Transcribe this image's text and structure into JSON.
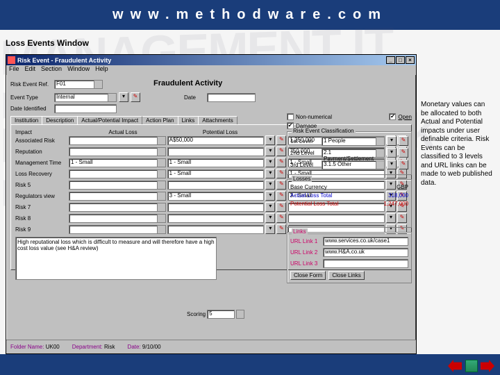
{
  "header": {
    "url": "www.methodware.com"
  },
  "section_title": "Loss Events Window",
  "callout": "Monetary values can be allocated to both Actual and Potential impacts under user definable criteria. Risk Events can be classified to 3 levels and URL links can be made to web published data.",
  "window": {
    "title": "Risk Event - Fraudulent Activity",
    "menu": [
      "File",
      "Edit",
      "Section",
      "Window",
      "Help"
    ],
    "risk_event_ref_label": "Risk Event Ref.",
    "risk_event_ref_value": "F01",
    "risk_event_name": "Fraudulent Activity",
    "event_type_label": "Event Type",
    "event_type_value": "Internal",
    "date_label": "Date",
    "date_value": "",
    "date_identified_label": "Date Identified",
    "date_identified_value": "",
    "cb_non_numerical": "Non-numerical",
    "cb_open": "Open",
    "cb_damage": "Damage",
    "tabs": [
      "Institution",
      "Description",
      "Actual/Potential Impact",
      "Action Plan",
      "Links",
      "Attachments"
    ],
    "col_headers": {
      "impact": "Impact",
      "actual": "Actual Loss",
      "potential": "Potential Loss"
    },
    "impact_rows": [
      {
        "label": "Associated Risk",
        "level": "",
        "actual": "A$50,000",
        "potential": "1,250,000"
      },
      {
        "label": "Reputation",
        "level": "",
        "actual": "",
        "potential": "750,000"
      },
      {
        "label": "Management Time",
        "level": "1 - Small",
        "actual": "1 - Small",
        "potential": "1 - Small"
      },
      {
        "label": "Loss Recovery",
        "level": "",
        "actual": "1 - Small",
        "potential": "1 - Small"
      },
      {
        "label": "Risk 5",
        "level": "",
        "actual": "",
        "potential": ""
      },
      {
        "label": "Regulators view",
        "level": "",
        "actual": "3 - Small",
        "potential": "3 - Small"
      },
      {
        "label": "Risk 7",
        "level": "",
        "actual": "",
        "potential": ""
      },
      {
        "label": "Risk 8",
        "level": "",
        "actual": "",
        "potential": ""
      },
      {
        "label": "Risk 9",
        "level": "",
        "actual": "",
        "potential": ""
      }
    ],
    "notes": "High reputational loss which is difficult to measure and will therefore have a high cost loss value (see H&A review)",
    "classification": {
      "title": "Risk Event Classification",
      "l1_label": "1st Level",
      "l1_value": "1 People",
      "l2_label": "2nd Level",
      "l2_value": "2.1 Payment/Settlement",
      "l3_label": "3rd Level",
      "l3_value": "3.1.5 Other"
    },
    "losses": {
      "title": "Losses",
      "base_currency_label": "Base Currency",
      "base_currency_value": "GBP",
      "actual_total_label": "Actual Loss Total",
      "actual_total_value": "318,000",
      "potential_total_label": "Potential Loss Total",
      "potential_total_value": "1,247,000"
    },
    "links": {
      "title": "Links",
      "l1_label": "URL Link 1",
      "l1_value": "www.services.co.uk/case1",
      "l2_label": "URL Link 2",
      "l2_value": "www.H&A.co.uk",
      "l3_label": "URL Link 3",
      "l3_value": ""
    },
    "buttons": {
      "close_form": "Close Form",
      "close_links": "Close Links"
    },
    "stepper": {
      "label": "Scoring",
      "value": "5"
    },
    "status": {
      "folder_label": "Folder Name:",
      "folder_value": "UK00",
      "dept_label": "Department:",
      "dept_value": "Risk",
      "date_label": "Date:",
      "date_value": "9/10/00"
    }
  }
}
